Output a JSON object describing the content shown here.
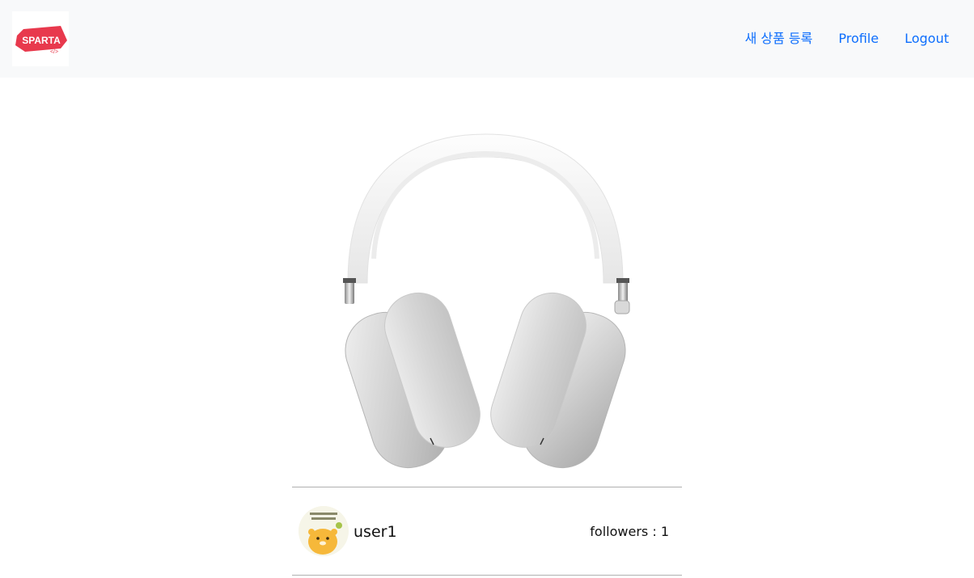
{
  "navbar": {
    "brand_logo_text": "SPARTA",
    "links": [
      {
        "label": "새 상품 등록"
      },
      {
        "label": "Profile"
      },
      {
        "label": "Logout"
      }
    ],
    "link_color": "#0d6efd",
    "background": "#f8f9fa"
  },
  "product": {
    "image_icon": "headphones-image"
  },
  "seller": {
    "username": "user1",
    "followers_label": "followers : ",
    "followers_count": "1",
    "avatar_icon": "character-avatar"
  }
}
